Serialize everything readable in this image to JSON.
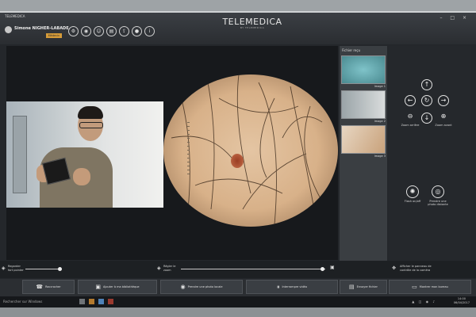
{
  "window": {
    "title": "TELEMEDICA"
  },
  "app": {
    "brand": "TELEMEDICA",
    "brand_sub": "BY TELEMEDICA"
  },
  "user": {
    "name": "Simone NIGHER-LABADE",
    "role": "Médecin"
  },
  "header": {
    "icons": [
      "settings-icon",
      "camera-icon",
      "patient-icon",
      "folder-icon",
      "share-icon",
      "record-icon",
      "info-icon"
    ],
    "controls": "– □ ×"
  },
  "controls_bar": {
    "left_label_1": "Regarder",
    "left_label_2": "fort pointer",
    "mid_label_1": "Régler le",
    "mid_label_2": "zoom",
    "right_label_1": "Afficher le panneau de",
    "right_label_2": "contrôle de la caméra"
  },
  "actions": [
    {
      "icon": "phone-icon",
      "label": "Raccrocher"
    },
    {
      "icon": "photo-icon",
      "label": "Ajouter à ma bibliothèque"
    },
    {
      "icon": "camera-icon",
      "label": "Prendre une photo locale"
    },
    {
      "icon": "pause-icon",
      "label": "Interrompre vidéo"
    },
    {
      "icon": "file-icon",
      "label": "Envoyer fichier"
    },
    {
      "icon": "monitor-icon",
      "label": "Montrer mon bureau"
    }
  ],
  "files_panel": {
    "title": "Fichier reçu",
    "items": [
      {
        "caption": "Image 1"
      },
      {
        "caption": "Image 2"
      },
      {
        "caption": "Image 3"
      }
    ]
  },
  "camera_panel": {
    "zoom_out_label": "Zoom arrière",
    "zoom_in_label": "Zoom avant",
    "flash_label": "Flash on/off",
    "remote_photo_label": "Prendre une photo distante"
  },
  "taskbar": {
    "search": "Rechercher sur Windows",
    "time": "14:00",
    "date": "06/04/2017"
  }
}
